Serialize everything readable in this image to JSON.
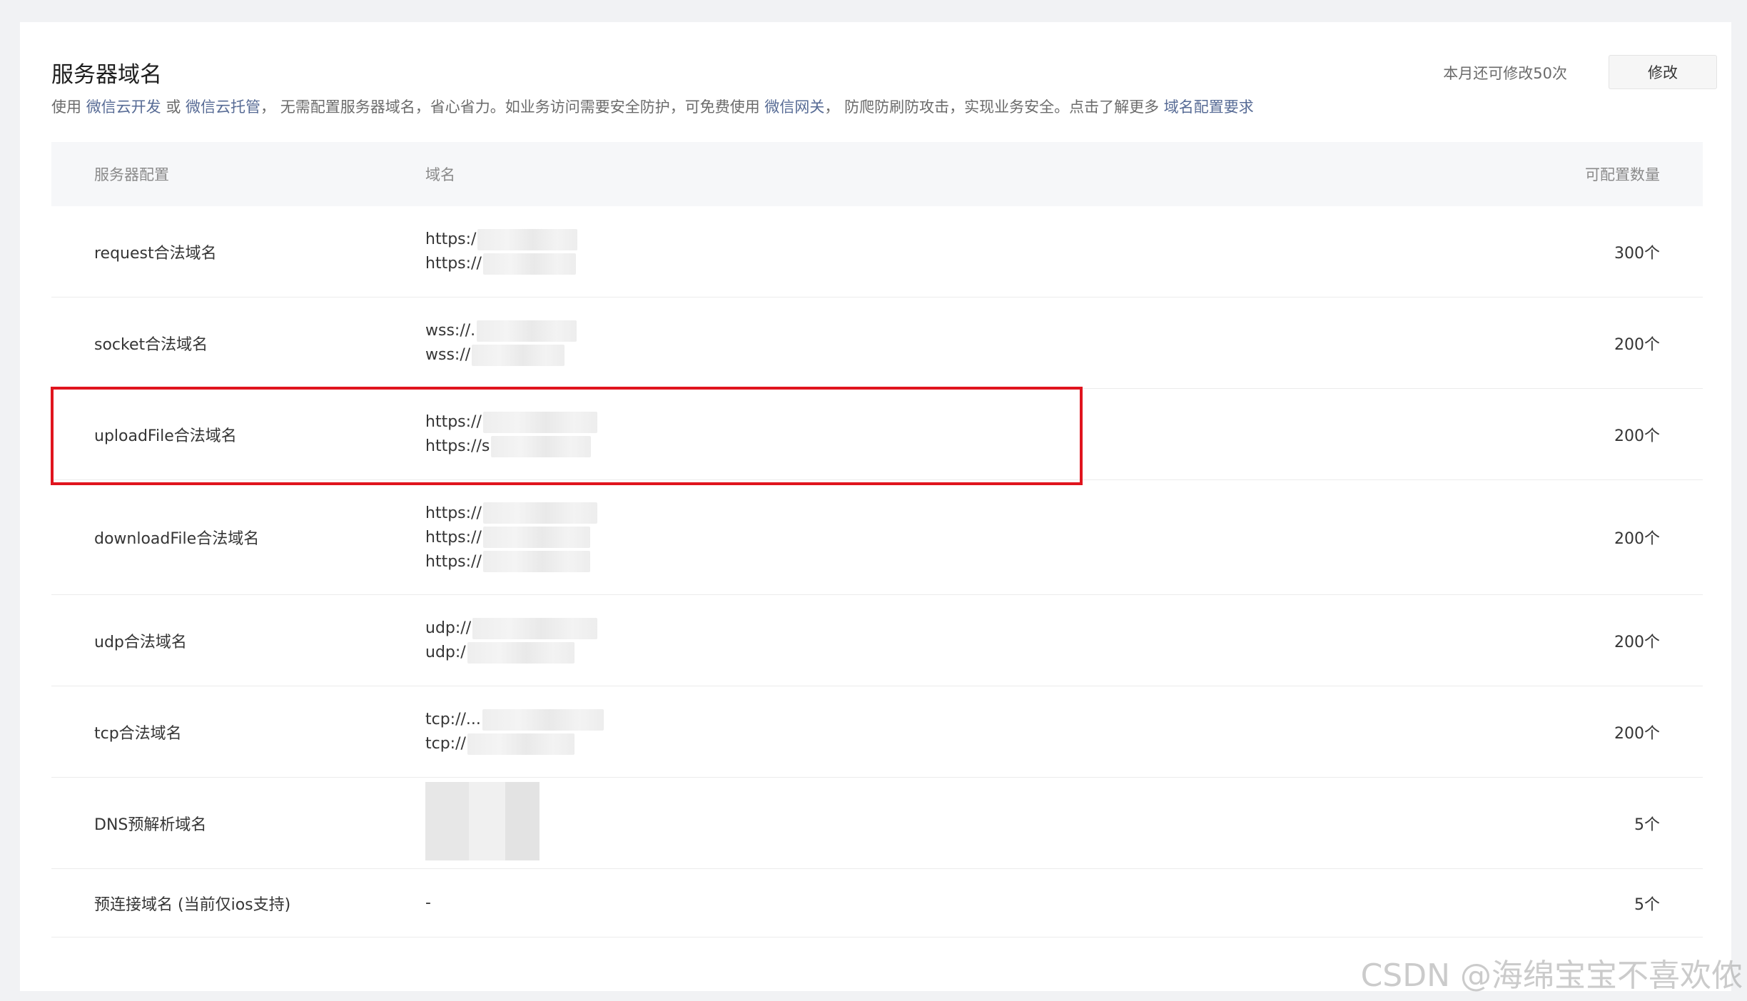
{
  "header": {
    "title": "服务器域名",
    "desc_parts": [
      {
        "text": "使用 ",
        "link": false
      },
      {
        "text": "微信云开发",
        "link": true
      },
      {
        "text": " 或 ",
        "link": false
      },
      {
        "text": "微信云托管",
        "link": true
      },
      {
        "text": "， 无需配置服务器域名，省心省力。如业务访问需要安全防护，可免费使用 ",
        "link": false
      },
      {
        "text": "微信网关",
        "link": true
      },
      {
        "text": "， 防爬防刷防攻击，实现业务安全。点击了解更多 ",
        "link": false
      },
      {
        "text": "域名配置要求",
        "link": true
      }
    ],
    "remaining": "本月还可修改50次",
    "modify_label": "修改"
  },
  "table": {
    "headers": {
      "config": "服务器配置",
      "domain": "域名",
      "count": "可配置数量"
    },
    "rows": [
      {
        "name": "request合法域名",
        "domains": [
          "https:/",
          "https://"
        ],
        "count": "300个"
      },
      {
        "name": "socket合法域名",
        "domains": [
          "wss://.",
          "wss://"
        ],
        "count": "200个"
      },
      {
        "name": "uploadFile合法域名",
        "domains": [
          "https://",
          "https://s"
        ],
        "count": "200个"
      },
      {
        "name": "downloadFile合法域名",
        "domains": [
          "https://",
          "https://",
          "https://"
        ],
        "count": "200个"
      },
      {
        "name": "udp合法域名",
        "domains": [
          "udp://",
          "udp:/"
        ],
        "count": "200个"
      },
      {
        "name": "tcp合法域名",
        "domains": [
          "tcp://...",
          "tcp://"
        ],
        "count": "200个"
      },
      {
        "name": "DNS预解析域名",
        "domains": [],
        "count": "5个"
      },
      {
        "name": "预连接域名 (当前仅ios支持)",
        "domains": [
          "-"
        ],
        "count": "5个"
      }
    ]
  },
  "watermark": "CSDN @海绵宝宝不喜欢侬"
}
